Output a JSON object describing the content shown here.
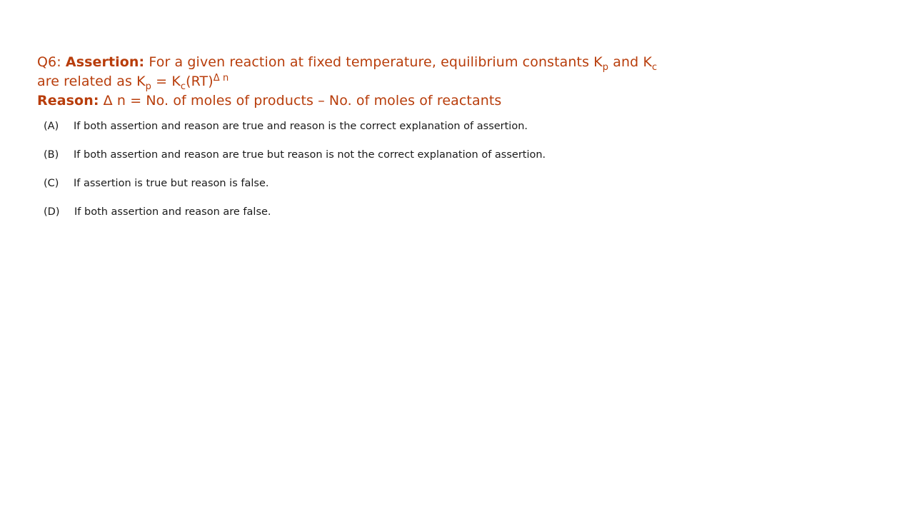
{
  "question": {
    "number": "Q6:",
    "assertion_label": "Assertion:",
    "assertion_text_1": " For a given reaction at fixed temperature, equilibrium constants K",
    "kp_sub_1": "p",
    "and_word": " and K",
    "kc_sub_1": "c",
    "line2_prefix": "are related as K",
    "kp_sub_2": "p",
    "equals_k": " = K",
    "kc_sub_2": "c",
    "rt": "(RT)",
    "delta_n_sup": "Δ n",
    "reason_label": "Reason:",
    "reason_text": " Δ n = No. of moles of products – No. of moles of reactants"
  },
  "options": [
    {
      "letter": "(A)",
      "text": "If both assertion and reason are true and reason is the correct explanation of assertion."
    },
    {
      "letter": "(B)",
      "text": "If both assertion and reason are true but reason is not the correct explanation of assertion."
    },
    {
      "letter": "(C)",
      "text": "If assertion is true but reason is false."
    },
    {
      "letter": "(D)",
      "text": "If both assertion and reason are false."
    }
  ],
  "colors": {
    "question_text": "#b83d0b",
    "option_text": "#1a1a1a",
    "background": "#ffffff"
  }
}
